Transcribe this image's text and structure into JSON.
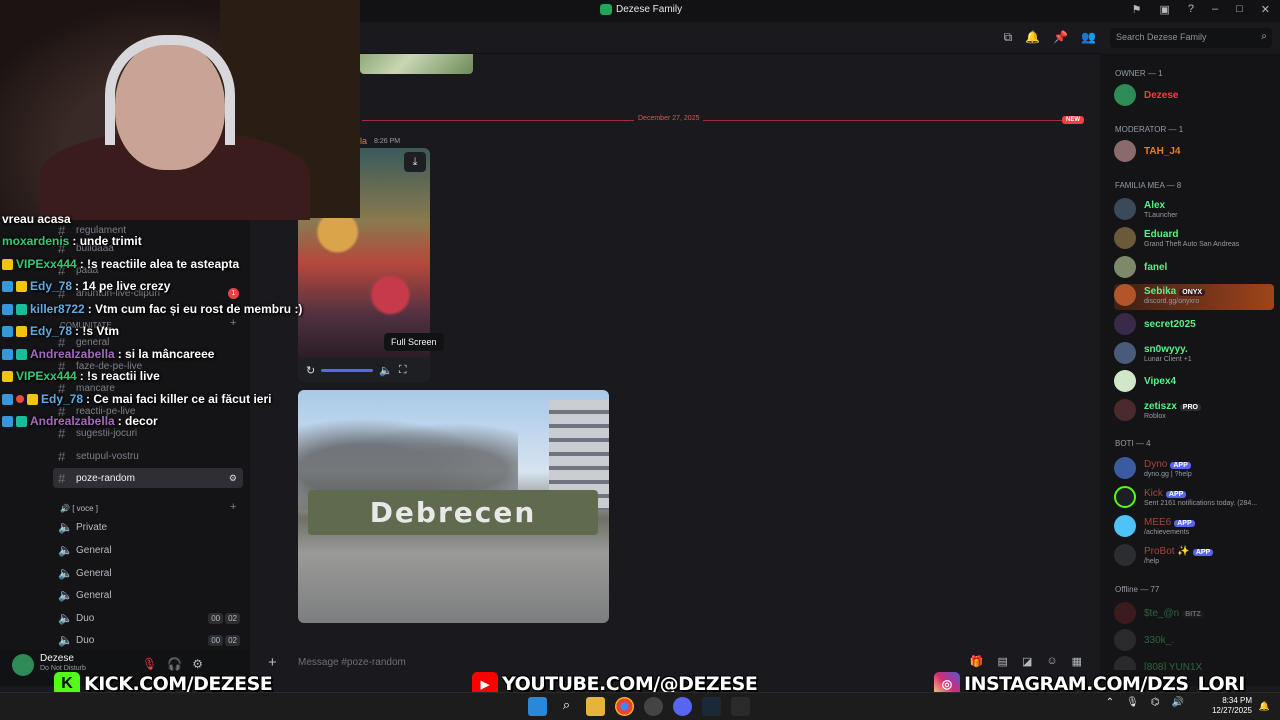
{
  "window": {
    "title": "Dezese Family"
  },
  "search": {
    "placeholder": "Search Dezese Family"
  },
  "channels": {
    "regulament": "regulament",
    "buildaaa": "buildaaa",
    "paaa": "paaa",
    "anunturi": "anunturi-live-clipuri",
    "anunturi_badge": "1",
    "category_comunitate": "COMUNITATE",
    "general": "general",
    "faze": "faze-de-pe-live",
    "mancare": "mancare",
    "reactii": "reactii-pe-live",
    "sugestii": "sugestii-jocuri",
    "setupul": "setupul-vostru",
    "active": "poze-random",
    "category_voce": "[ voce ]",
    "voice": [
      {
        "name": "Private",
        "count_a": "",
        "count_b": ""
      },
      {
        "name": "General",
        "count_a": "",
        "count_b": ""
      },
      {
        "name": "General",
        "count_a": "",
        "count_b": ""
      },
      {
        "name": "General",
        "count_a": "",
        "count_b": ""
      },
      {
        "name": "Duo",
        "count_a": "00",
        "count_b": "02"
      },
      {
        "name": "Duo",
        "count_a": "00",
        "count_b": "02"
      }
    ]
  },
  "user": {
    "name": "Dezese",
    "status": "Do Not Disturb"
  },
  "messages": {
    "divider_date": "December 27, 2025",
    "new_badge": "NEW",
    "author": "la",
    "timestamp": "8:26 PM",
    "tooltip": "Full Screen",
    "photo_sign": "Debrecen"
  },
  "composer": {
    "placeholder": "Message #poze-random"
  },
  "members": {
    "owner_header": "OWNER — 1",
    "owner": {
      "name": "Dezese",
      "color": "#f23f43"
    },
    "mod_header": "MODERATOR — 1",
    "mod": {
      "name": "TAH_J4",
      "color": "#e67e22"
    },
    "familia_header": "FAMILIA MEA — 8",
    "familia": [
      {
        "name": "Alex",
        "sub": "TLauncher",
        "color": "#57f287",
        "tag": ""
      },
      {
        "name": "Eduard",
        "sub": "Grand Theft Auto San Andreas",
        "color": "#57f287",
        "tag": ""
      },
      {
        "name": "fanel",
        "sub": "",
        "color": "#57f287",
        "tag": ""
      },
      {
        "name": "Sebika",
        "sub": "discord.gg/onyxro",
        "color": "#57f287",
        "tag": "ONYX"
      },
      {
        "name": "secret2025",
        "sub": "",
        "color": "#57f287",
        "tag": ""
      },
      {
        "name": "sn0wyyy.",
        "sub": "Lunar Client +1",
        "color": "#57f287",
        "tag": ""
      },
      {
        "name": "Vipex4",
        "sub": "",
        "color": "#57f287",
        "tag": ""
      },
      {
        "name": "zetiszx",
        "sub": "Roblox",
        "color": "#57f287",
        "tag": "PRO"
      }
    ],
    "bots_header": "BOTI — 4",
    "bots": [
      {
        "name": "Dyno",
        "sub": "dyno.gg | ?help",
        "color": "#a6453d",
        "tag": "APP"
      },
      {
        "name": "Kick",
        "sub": "Sent 2161 notifications today. (284...",
        "color": "#a6453d",
        "tag": "APP"
      },
      {
        "name": "MEE6",
        "sub": "/achievements",
        "color": "#a6453d",
        "tag": "APP"
      },
      {
        "name": "ProBot ✨",
        "sub": "/help",
        "color": "#a6453d",
        "tag": "APP"
      }
    ],
    "offline_header": "Offline — 77",
    "offline": [
      {
        "name": "$te_@n",
        "tag": "BITZ"
      },
      {
        "name": "330k_.",
        "tag": ""
      },
      {
        "name": "[808] YUN1X",
        "tag": ""
      }
    ]
  },
  "chat": [
    {
      "user": "",
      "text": "vreau acasa",
      "color": "#ffffff"
    },
    {
      "user": "moxardenis",
      "text": ": unde trimit",
      "color": "#2ecc71"
    },
    {
      "user": "VIPExx444",
      "text": ": !s reactiile alea te asteapta",
      "color": "#2ecc71"
    },
    {
      "user": "Edy_78",
      "text": ": 14 pe live crezy",
      "color": "#5dade2"
    },
    {
      "user": "killer8722",
      "text": ": Vtm cum fac și eu rost de membru :)",
      "color": "#5dade2"
    },
    {
      "user": "Edy_78",
      "text": ": !s Vtm",
      "color": "#5dade2"
    },
    {
      "user": "Andrealzabella",
      "text": ": si la mâncareee",
      "color": "#a569bd"
    },
    {
      "user": "VIPExx444",
      "text": ": !s reactii live",
      "color": "#2ecc71"
    },
    {
      "user": "Edy_78",
      "text": ": Ce mai faci killer ce ai făcut ieri",
      "color": "#5dade2"
    },
    {
      "user": "Andrealzabella",
      "text": ": decor",
      "color": "#a569bd"
    }
  ],
  "socials": {
    "kick": "KICK.COM/DEZESE",
    "youtube": "YOUTUBE.COM/@DEZESE",
    "instagram": "INSTAGRAM.COM/DZS_LORI"
  },
  "taskbar": {
    "time": "8:34 PM",
    "date": "12/27/2025"
  }
}
